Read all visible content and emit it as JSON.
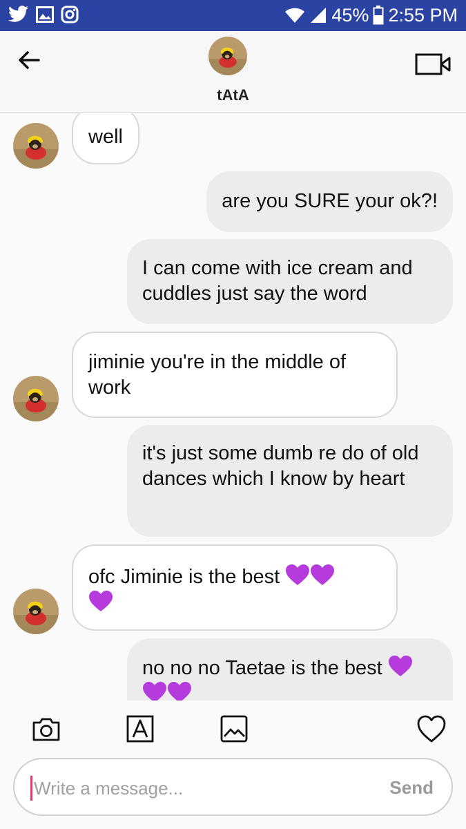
{
  "status_bar": {
    "battery": "45%",
    "time": "2:55 PM",
    "icons": [
      "twitter-icon",
      "gallery-icon",
      "instagram-icon",
      "wifi-icon",
      "signal-icon",
      "battery-icon"
    ]
  },
  "header": {
    "name": "tAtA",
    "icons": [
      "back-arrow-icon",
      "video-call-icon"
    ]
  },
  "messages": [
    {
      "direction": "in",
      "text": "well"
    },
    {
      "direction": "out",
      "text": "are you SURE your ok?!"
    },
    {
      "direction": "out",
      "text": "I can come with ice cream and cuddles just say the word"
    },
    {
      "direction": "in",
      "text": "jiminie you're in the middle of work"
    },
    {
      "direction": "out",
      "text": "it's just some dumb re do of old dances which I know by heart"
    },
    {
      "direction": "in",
      "text": "ofc Jiminie is the best",
      "trailing_hearts": 3
    },
    {
      "direction": "out",
      "text": "no no no Taetae is the best",
      "trailing_hearts": 3
    }
  ],
  "toolbar": {
    "icons": [
      "camera-icon",
      "text-style-icon",
      "image-icon",
      "heart-icon"
    ]
  },
  "composer": {
    "placeholder": "Write a message...",
    "send_label": "Send"
  },
  "colors": {
    "status_bar": "#2b43a2",
    "heart": "#b53bdc",
    "caret": "#e5386d"
  }
}
